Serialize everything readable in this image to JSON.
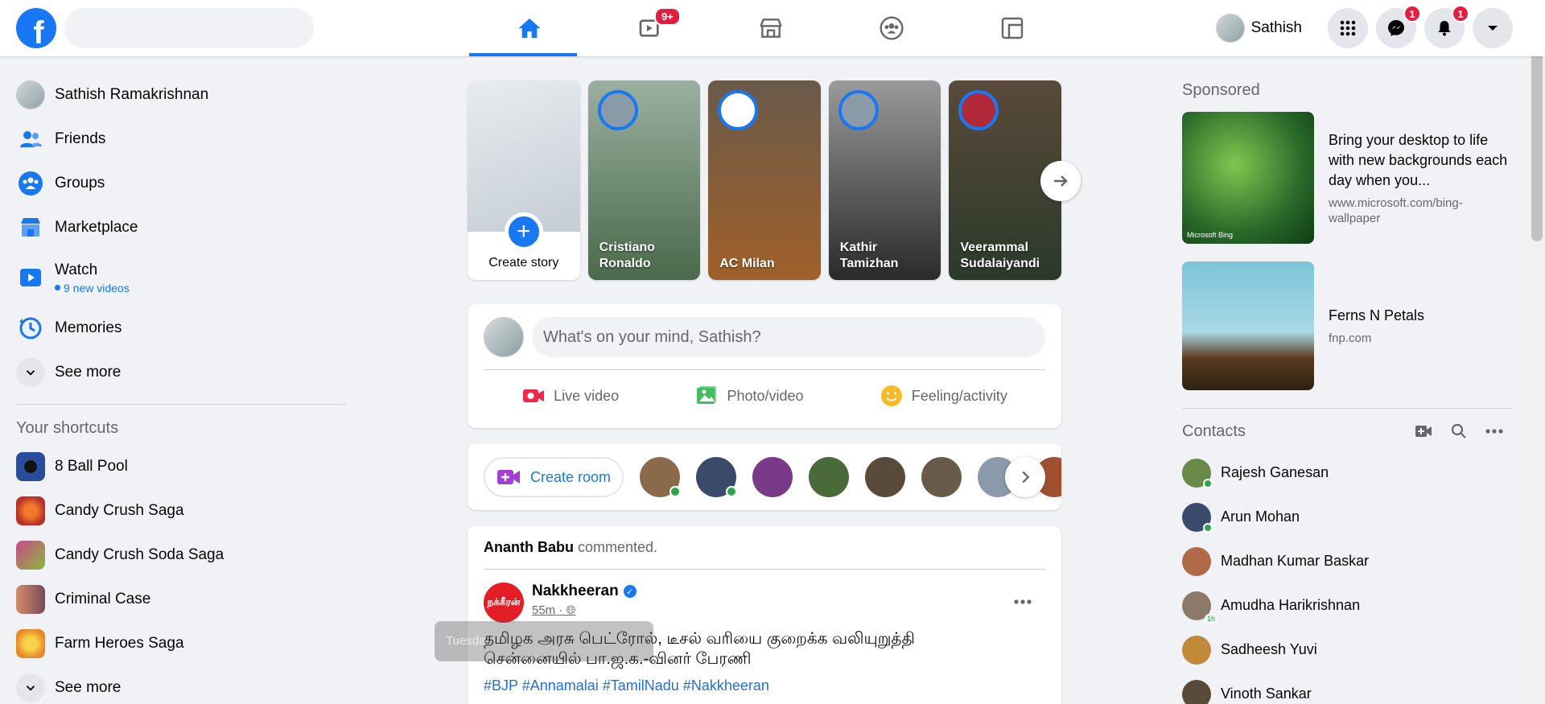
{
  "topbar": {
    "logo_letter": "f",
    "watch_badge": "9+",
    "profile_name": "Sathish",
    "messenger_badge": "1",
    "notifications_badge": "1"
  },
  "left_sidebar": {
    "profile_name": "Sathish Ramakrishnan",
    "items": [
      {
        "label": "Friends",
        "icon": "friends-icon"
      },
      {
        "label": "Groups",
        "icon": "groups-icon"
      },
      {
        "label": "Marketplace",
        "icon": "marketplace-icon"
      }
    ],
    "watch": {
      "label": "Watch",
      "sub": "9 new videos"
    },
    "memories": "Memories",
    "see_more": "See more",
    "shortcuts_title": "Your shortcuts",
    "shortcuts": [
      {
        "label": "8 Ball Pool",
        "color": "#2a4d9b"
      },
      {
        "label": "Candy Crush Saga",
        "color": "#d9462b"
      },
      {
        "label": "Candy Crush Soda Saga",
        "color": "#8ab83b"
      },
      {
        "label": "Criminal Case",
        "color": "#b85a7a"
      },
      {
        "label": "Farm Heroes Saga",
        "color": "#f2a93b"
      }
    ],
    "shortcuts_see_more": "See more"
  },
  "stories": {
    "create_label": "Create story",
    "items": [
      {
        "name": "Cristiano Ronaldo",
        "bg": "#6a8a6a"
      },
      {
        "name": "AC Milan",
        "bg": "#8a5a2e"
      },
      {
        "name": "Kathir Tamizhan",
        "bg": "#555555"
      },
      {
        "name": "Veerammal Sudalaiyandi",
        "bg": "#3d4a3a"
      }
    ]
  },
  "composer": {
    "placeholder": "What's on your mind, Sathish?",
    "live": "Live video",
    "photo": "Photo/video",
    "feeling": "Feeling/activity"
  },
  "rooms": {
    "create_label": "Create room",
    "avatars": [
      {
        "color": "#8a6a4a",
        "online": true
      },
      {
        "color": "#3a4a6a",
        "online": true
      },
      {
        "color": "#7a3a8a",
        "online": false
      },
      {
        "color": "#4a6a3a",
        "online": false
      },
      {
        "color": "#5a4a3a",
        "online": false
      },
      {
        "color": "#6a5a4a",
        "online": false
      },
      {
        "color": "#8a9aaa",
        "online": false
      },
      {
        "color": "#a05030",
        "online": false
      }
    ]
  },
  "post": {
    "actor": "Ananth Babu",
    "action": "commented.",
    "page_name": "Nakkheeran",
    "page_logo_text": "நக்கீரன்",
    "time": "55m",
    "text_line1": "தமிழக அரசு பெட்ரோல், டீசல் வரியை குறைக்க வலியுறுத்தி",
    "text_line2": "சென்னையில் பா.ஜ.க.-வினர் பேரணி",
    "tags": "#BJP #Annamalai #TamilNadu #Nakkheeran",
    "tooltip": "Tuesda"
  },
  "right_sidebar": {
    "sponsored_title": "Sponsored",
    "ads": [
      {
        "title": "Bring your desktop to life with new backgrounds each day when you...",
        "url": "www.microsoft.com/bing-wallpaper",
        "badge": "Microsoft Bing"
      },
      {
        "title": "Ferns N Petals",
        "url": "fnp.com"
      }
    ],
    "contacts_title": "Contacts",
    "contacts": [
      {
        "name": "Rajesh Ganesan",
        "color": "#6a8a4a",
        "online": true
      },
      {
        "name": "Arun Mohan",
        "color": "#3a4a6a",
        "online": true
      },
      {
        "name": "Madhan Kumar Baskar",
        "color": "#b06a4a",
        "online": false
      },
      {
        "name": "Amudha Harikrishnan",
        "color": "#8a7a6a",
        "online": false,
        "time": "1h"
      },
      {
        "name": "Sadheesh Yuvi",
        "color": "#c08a3a",
        "online": false
      },
      {
        "name": "Vinoth Sankar",
        "color": "#5a4a3a",
        "online": false
      }
    ]
  },
  "colors": {
    "accent": "#1877f2",
    "badge": "#e41e3f",
    "online": "#31a24c"
  }
}
